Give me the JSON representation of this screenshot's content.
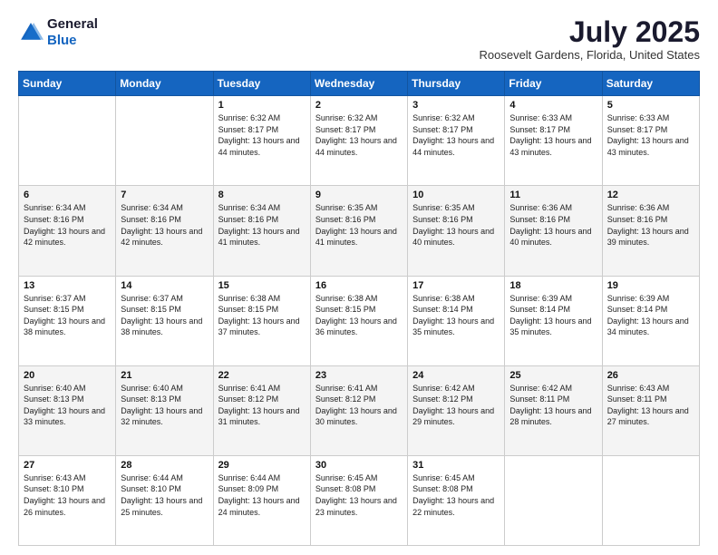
{
  "logo": {
    "general": "General",
    "blue": "Blue"
  },
  "header": {
    "month": "July 2025",
    "location": "Roosevelt Gardens, Florida, United States"
  },
  "weekdays": [
    "Sunday",
    "Monday",
    "Tuesday",
    "Wednesday",
    "Thursday",
    "Friday",
    "Saturday"
  ],
  "weeks": [
    [
      {
        "day": "",
        "info": ""
      },
      {
        "day": "",
        "info": ""
      },
      {
        "day": "1",
        "info": "Sunrise: 6:32 AM\nSunset: 8:17 PM\nDaylight: 13 hours and 44 minutes."
      },
      {
        "day": "2",
        "info": "Sunrise: 6:32 AM\nSunset: 8:17 PM\nDaylight: 13 hours and 44 minutes."
      },
      {
        "day": "3",
        "info": "Sunrise: 6:32 AM\nSunset: 8:17 PM\nDaylight: 13 hours and 44 minutes."
      },
      {
        "day": "4",
        "info": "Sunrise: 6:33 AM\nSunset: 8:17 PM\nDaylight: 13 hours and 43 minutes."
      },
      {
        "day": "5",
        "info": "Sunrise: 6:33 AM\nSunset: 8:17 PM\nDaylight: 13 hours and 43 minutes."
      }
    ],
    [
      {
        "day": "6",
        "info": "Sunrise: 6:34 AM\nSunset: 8:16 PM\nDaylight: 13 hours and 42 minutes."
      },
      {
        "day": "7",
        "info": "Sunrise: 6:34 AM\nSunset: 8:16 PM\nDaylight: 13 hours and 42 minutes."
      },
      {
        "day": "8",
        "info": "Sunrise: 6:34 AM\nSunset: 8:16 PM\nDaylight: 13 hours and 41 minutes."
      },
      {
        "day": "9",
        "info": "Sunrise: 6:35 AM\nSunset: 8:16 PM\nDaylight: 13 hours and 41 minutes."
      },
      {
        "day": "10",
        "info": "Sunrise: 6:35 AM\nSunset: 8:16 PM\nDaylight: 13 hours and 40 minutes."
      },
      {
        "day": "11",
        "info": "Sunrise: 6:36 AM\nSunset: 8:16 PM\nDaylight: 13 hours and 40 minutes."
      },
      {
        "day": "12",
        "info": "Sunrise: 6:36 AM\nSunset: 8:16 PM\nDaylight: 13 hours and 39 minutes."
      }
    ],
    [
      {
        "day": "13",
        "info": "Sunrise: 6:37 AM\nSunset: 8:15 PM\nDaylight: 13 hours and 38 minutes."
      },
      {
        "day": "14",
        "info": "Sunrise: 6:37 AM\nSunset: 8:15 PM\nDaylight: 13 hours and 38 minutes."
      },
      {
        "day": "15",
        "info": "Sunrise: 6:38 AM\nSunset: 8:15 PM\nDaylight: 13 hours and 37 minutes."
      },
      {
        "day": "16",
        "info": "Sunrise: 6:38 AM\nSunset: 8:15 PM\nDaylight: 13 hours and 36 minutes."
      },
      {
        "day": "17",
        "info": "Sunrise: 6:38 AM\nSunset: 8:14 PM\nDaylight: 13 hours and 35 minutes."
      },
      {
        "day": "18",
        "info": "Sunrise: 6:39 AM\nSunset: 8:14 PM\nDaylight: 13 hours and 35 minutes."
      },
      {
        "day": "19",
        "info": "Sunrise: 6:39 AM\nSunset: 8:14 PM\nDaylight: 13 hours and 34 minutes."
      }
    ],
    [
      {
        "day": "20",
        "info": "Sunrise: 6:40 AM\nSunset: 8:13 PM\nDaylight: 13 hours and 33 minutes."
      },
      {
        "day": "21",
        "info": "Sunrise: 6:40 AM\nSunset: 8:13 PM\nDaylight: 13 hours and 32 minutes."
      },
      {
        "day": "22",
        "info": "Sunrise: 6:41 AM\nSunset: 8:12 PM\nDaylight: 13 hours and 31 minutes."
      },
      {
        "day": "23",
        "info": "Sunrise: 6:41 AM\nSunset: 8:12 PM\nDaylight: 13 hours and 30 minutes."
      },
      {
        "day": "24",
        "info": "Sunrise: 6:42 AM\nSunset: 8:12 PM\nDaylight: 13 hours and 29 minutes."
      },
      {
        "day": "25",
        "info": "Sunrise: 6:42 AM\nSunset: 8:11 PM\nDaylight: 13 hours and 28 minutes."
      },
      {
        "day": "26",
        "info": "Sunrise: 6:43 AM\nSunset: 8:11 PM\nDaylight: 13 hours and 27 minutes."
      }
    ],
    [
      {
        "day": "27",
        "info": "Sunrise: 6:43 AM\nSunset: 8:10 PM\nDaylight: 13 hours and 26 minutes."
      },
      {
        "day": "28",
        "info": "Sunrise: 6:44 AM\nSunset: 8:10 PM\nDaylight: 13 hours and 25 minutes."
      },
      {
        "day": "29",
        "info": "Sunrise: 6:44 AM\nSunset: 8:09 PM\nDaylight: 13 hours and 24 minutes."
      },
      {
        "day": "30",
        "info": "Sunrise: 6:45 AM\nSunset: 8:08 PM\nDaylight: 13 hours and 23 minutes."
      },
      {
        "day": "31",
        "info": "Sunrise: 6:45 AM\nSunset: 8:08 PM\nDaylight: 13 hours and 22 minutes."
      },
      {
        "day": "",
        "info": ""
      },
      {
        "day": "",
        "info": ""
      }
    ]
  ]
}
